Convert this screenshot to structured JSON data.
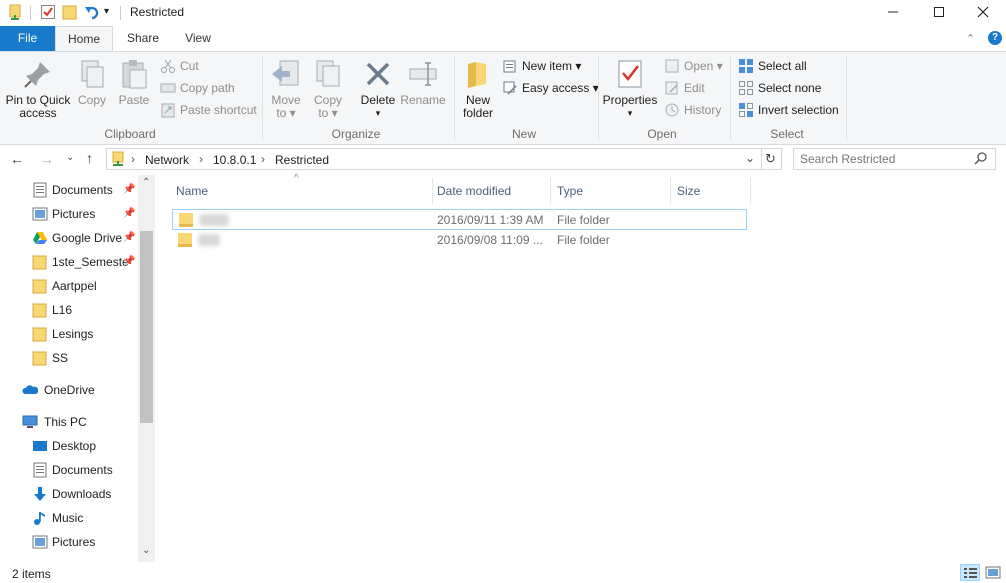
{
  "window": {
    "title": "Restricted"
  },
  "tabs": {
    "file": "File",
    "home": "Home",
    "share": "Share",
    "view": "View"
  },
  "ribbon": {
    "clipboard": {
      "label": "Clipboard",
      "pin_line1": "Pin to Quick",
      "pin_line2": "access",
      "copy": "Copy",
      "paste": "Paste",
      "cut": "Cut",
      "copy_path": "Copy path",
      "paste_shortcut": "Paste shortcut"
    },
    "organize": {
      "label": "Organize",
      "move_line1": "Move",
      "move_line2": "to ▾",
      "copy_line1": "Copy",
      "copy_line2": "to ▾",
      "delete": "Delete",
      "delete_arrow": "▾",
      "rename": "Rename"
    },
    "new": {
      "label": "New",
      "folder_line1": "New",
      "folder_line2": "folder",
      "new_item": "New item ▾",
      "easy_access": "Easy access ▾"
    },
    "open": {
      "label": "Open",
      "properties": "Properties",
      "properties_arrow": "▾",
      "open": "Open ▾",
      "edit": "Edit",
      "history": "History"
    },
    "select": {
      "label": "Select",
      "select_all": "Select all",
      "select_none": "Select none",
      "invert": "Invert selection"
    }
  },
  "address": {
    "crumbs": [
      "Network",
      "10.8.0.1",
      "Restricted"
    ],
    "separator": "›",
    "search_placeholder": "Search Restricted"
  },
  "nav": {
    "quick_access": [
      {
        "label": "Documents",
        "pinned": true
      },
      {
        "label": "Pictures",
        "pinned": true
      },
      {
        "label": "Google Drive",
        "pinned": true
      },
      {
        "label": "1ste_Semeste",
        "pinned": true
      },
      {
        "label": "Aartppel",
        "pinned": false
      },
      {
        "label": "L16",
        "pinned": false
      },
      {
        "label": "Lesings",
        "pinned": false
      },
      {
        "label": "SS",
        "pinned": false
      }
    ],
    "onedrive": "OneDrive",
    "this_pc": "This PC",
    "pc_items": [
      "Desktop",
      "Documents",
      "Downloads",
      "Music",
      "Pictures"
    ]
  },
  "columns": {
    "name": "Name",
    "date": "Date modified",
    "type": "Type",
    "size": "Size"
  },
  "files": [
    {
      "date": "2016/09/11 1:39 AM",
      "type": "File folder",
      "selected": true
    },
    {
      "date": "2016/09/08 11:09 ...",
      "type": "File folder",
      "selected": false
    }
  ],
  "status": {
    "count": "2 items"
  },
  "colors": {
    "accent": "#1979ca",
    "folder": "#f8d775",
    "selection": "#99d1ff"
  }
}
